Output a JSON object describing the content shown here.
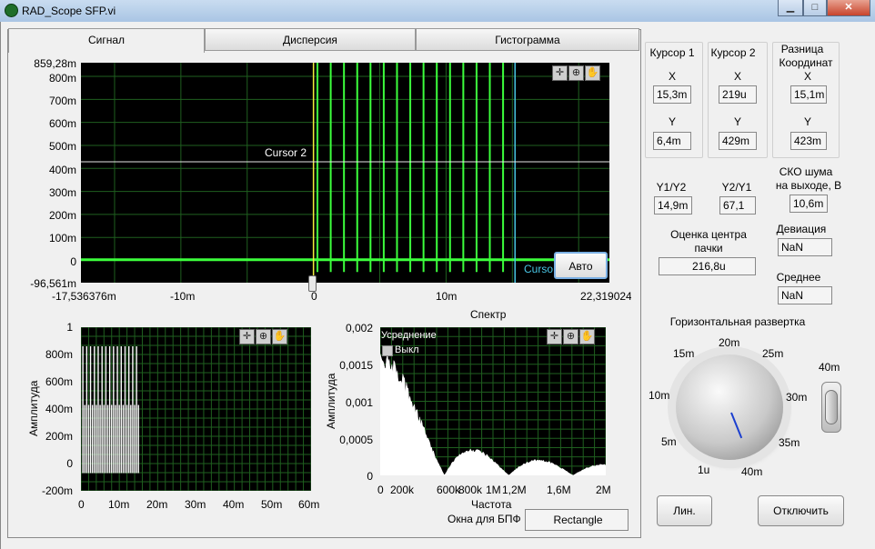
{
  "window": {
    "title": "RAD_Scope SFP.vi"
  },
  "tabs": [
    {
      "label": "Сигнал"
    },
    {
      "label": "Дисперсия"
    },
    {
      "label": "Гистограмма"
    }
  ],
  "main_chart": {
    "y_ticks": [
      "859,28m",
      "800m",
      "700m",
      "600m",
      "500m",
      "400m",
      "300m",
      "200m",
      "100m",
      "0",
      "-96,561m"
    ],
    "x_ticks": [
      "-17,536376m",
      "-10m",
      "0",
      "10m",
      "22,319024r"
    ],
    "cursor2_label": "Cursor 2",
    "cursor_trunc": "Curso",
    "auto_button": "Авто"
  },
  "chart_data": [
    {
      "type": "line",
      "title": "",
      "xlabel": "",
      "ylabel": "",
      "xlim": [
        -0.017536376,
        0.022319024
      ],
      "ylim": [
        -0.096561,
        0.85928
      ],
      "series": [
        {
          "values": "pulse train, 0..15m, pulses ~every 1m"
        }
      ],
      "cursors": [
        {
          "x": 0.0,
          "y": 0.429
        },
        {
          "x": 0.0153,
          "y": 0.0064
        }
      ]
    },
    {
      "type": "line",
      "title": "",
      "xlabel": "",
      "ylabel": "Амплитуда",
      "xlim": [
        0,
        0.06
      ],
      "ylim": [
        -0.2,
        1
      ],
      "x_ticks": [
        "0",
        "10m",
        "20m",
        "30m",
        "40m",
        "50m",
        "60m"
      ],
      "y_ticks": [
        "1",
        "800m",
        "600m",
        "400m",
        "200m",
        "0",
        "-200m"
      ]
    },
    {
      "type": "area",
      "title": "Спектр",
      "xlabel": "Частота",
      "ylabel": "Амплитуда",
      "xlim": [
        0,
        2000000
      ],
      "ylim": [
        0,
        0.002
      ],
      "x_ticks": [
        "0",
        "200k",
        "600k",
        "800k",
        "1M",
        "1,2M",
        "1,6M",
        "2M"
      ],
      "y_ticks": [
        "0,002",
        "0,0015",
        "0,001",
        "0,0005",
        "0"
      ]
    }
  ],
  "hist_chart": {
    "ylabel": "Амплитуда",
    "x_ticks": [
      "0",
      "10m",
      "20m",
      "30m",
      "40m",
      "50m",
      "60m"
    ],
    "y_ticks": [
      "1",
      "800m",
      "600m",
      "400m",
      "200m",
      "0",
      "-200m"
    ]
  },
  "spectrum": {
    "title": "Спектр",
    "xlabel": "Частота",
    "ylabel": "Амплитуда",
    "averaging_label": "Усреднение",
    "averaging_state": "Выкл",
    "window_label": "Окна для БПФ",
    "window_value": "Rectangle",
    "x_ticks": [
      "0",
      "200k",
      "600k",
      "800k",
      "1M",
      "1,2M",
      "1,6M",
      "2M"
    ],
    "y_ticks": [
      "0,002",
      "0,0015",
      "0,001",
      "0,0005",
      "0"
    ]
  },
  "cursor1": {
    "title": "Курсор 1",
    "x_label": "X",
    "x_value": "15,3m",
    "y_label": "Y",
    "y_value": "6,4m"
  },
  "cursor2": {
    "title": "Курсор 2",
    "x_label": "X",
    "x_value": "219u",
    "y_label": "Y",
    "y_value": "429m"
  },
  "diff": {
    "title_line1": "Разница",
    "title_line2": "Координат",
    "x_label": "X",
    "x_value": "15,1m",
    "y_label": "Y",
    "y_value": "423m"
  },
  "ratios": {
    "y1y2_label": "Y1/Y2",
    "y1y2_value": "14,9m",
    "y2y1_label": "Y2/Y1",
    "y2y1_value": "67,1"
  },
  "noise": {
    "label_line1": "СКО шума",
    "label_line2": "на выходе, В",
    "value": "10,6m"
  },
  "center": {
    "label_line1": "Оценка центра",
    "label_line2": "пачки",
    "value": "216,8u"
  },
  "deviation": {
    "label": "Девиация",
    "value": "NaN"
  },
  "mean": {
    "label": "Среднее",
    "value": "NaN"
  },
  "sweep": {
    "label": "Горизонтальная развертка",
    "ticks": [
      "1u",
      "5m",
      "10m",
      "15m",
      "20m",
      "25m",
      "30m",
      "35m",
      "40m"
    ],
    "toggle_label": "40m"
  },
  "buttons": {
    "lin": "Лин.",
    "off": "Отключить"
  }
}
